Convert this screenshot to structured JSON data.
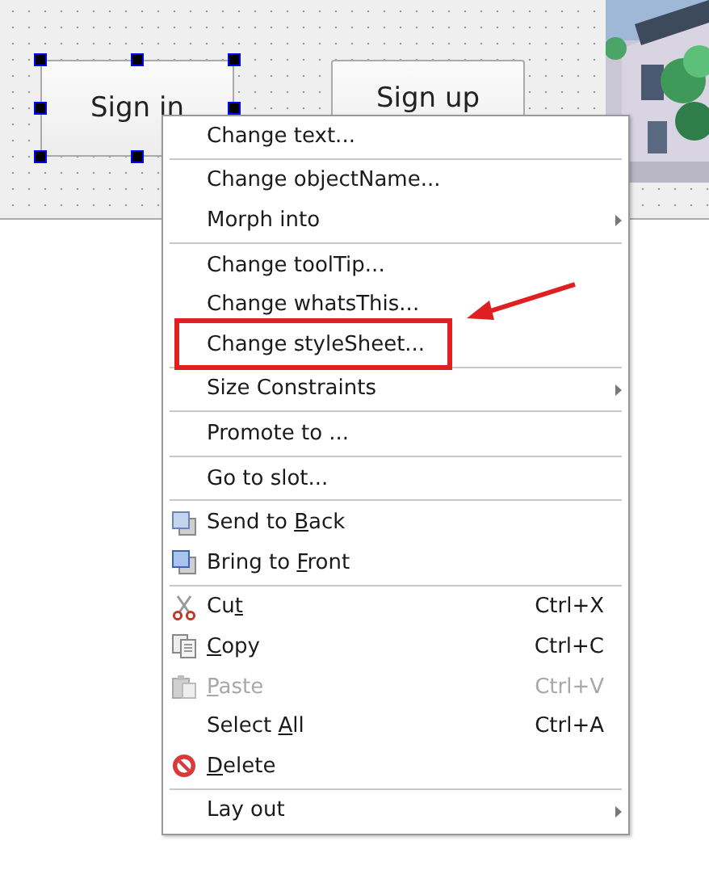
{
  "form": {
    "buttons": [
      {
        "label": "Sign in",
        "selected": true
      },
      {
        "label": "Sign up",
        "selected": false
      }
    ]
  },
  "context_menu": {
    "items": [
      {
        "kind": "plain",
        "pre": "Change text..."
      },
      {
        "kind": "separator"
      },
      {
        "kind": "plain",
        "pre": "Change objectName..."
      },
      {
        "kind": "plain",
        "pre": "Morph into",
        "submenu": true
      },
      {
        "kind": "separator"
      },
      {
        "kind": "plain",
        "pre": "Change toolTip..."
      },
      {
        "kind": "plain",
        "pre": "Change whatsThis..."
      },
      {
        "kind": "plain",
        "pre": "Change styleSheet...",
        "highlighted": true
      },
      {
        "kind": "separator"
      },
      {
        "kind": "plain",
        "pre": "Size Constraints",
        "submenu": true
      },
      {
        "kind": "separator"
      },
      {
        "kind": "plain",
        "pre": "Promote to ..."
      },
      {
        "kind": "separator"
      },
      {
        "kind": "plain",
        "pre": "Go to slot..."
      },
      {
        "kind": "separator"
      },
      {
        "kind": "send-back",
        "pre": "Send to ",
        "key": "B",
        "post": "ack"
      },
      {
        "kind": "bring-front",
        "pre": "Bring to ",
        "key": "F",
        "post": "ront"
      },
      {
        "kind": "separator"
      },
      {
        "kind": "cut",
        "pre": "Cu",
        "key": "t",
        "shortcut": "Ctrl+X",
        "disabled": false
      },
      {
        "kind": "copy",
        "key": "C",
        "post": "opy",
        "shortcut": "Ctrl+C",
        "disabled": false
      },
      {
        "kind": "paste",
        "key": "P",
        "post": "aste",
        "shortcut": "Ctrl+V",
        "disabled": true
      },
      {
        "kind": "plain",
        "pre": "Select ",
        "key": "A",
        "post": "ll",
        "shortcut": "Ctrl+A",
        "disabled": false
      },
      {
        "kind": "delete",
        "key": "D",
        "post": "elete"
      },
      {
        "kind": "separator"
      },
      {
        "kind": "plain",
        "pre": "Lay out",
        "submenu": true
      }
    ]
  }
}
